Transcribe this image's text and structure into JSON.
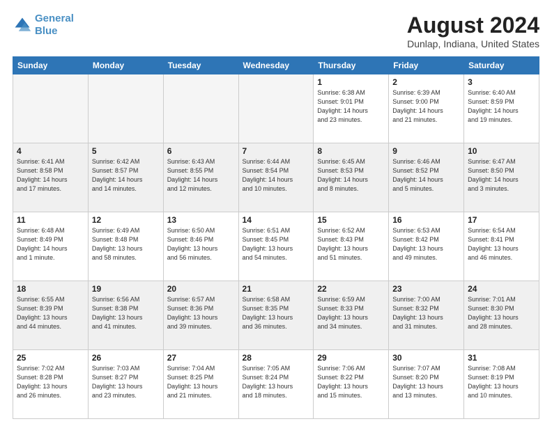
{
  "logo": {
    "line1": "General",
    "line2": "Blue"
  },
  "title": "August 2024",
  "subtitle": "Dunlap, Indiana, United States",
  "headers": [
    "Sunday",
    "Monday",
    "Tuesday",
    "Wednesday",
    "Thursday",
    "Friday",
    "Saturday"
  ],
  "weeks": [
    [
      {
        "num": "",
        "info": ""
      },
      {
        "num": "",
        "info": ""
      },
      {
        "num": "",
        "info": ""
      },
      {
        "num": "",
        "info": ""
      },
      {
        "num": "1",
        "info": "Sunrise: 6:38 AM\nSunset: 9:01 PM\nDaylight: 14 hours\nand 23 minutes."
      },
      {
        "num": "2",
        "info": "Sunrise: 6:39 AM\nSunset: 9:00 PM\nDaylight: 14 hours\nand 21 minutes."
      },
      {
        "num": "3",
        "info": "Sunrise: 6:40 AM\nSunset: 8:59 PM\nDaylight: 14 hours\nand 19 minutes."
      }
    ],
    [
      {
        "num": "4",
        "info": "Sunrise: 6:41 AM\nSunset: 8:58 PM\nDaylight: 14 hours\nand 17 minutes."
      },
      {
        "num": "5",
        "info": "Sunrise: 6:42 AM\nSunset: 8:57 PM\nDaylight: 14 hours\nand 14 minutes."
      },
      {
        "num": "6",
        "info": "Sunrise: 6:43 AM\nSunset: 8:55 PM\nDaylight: 14 hours\nand 12 minutes."
      },
      {
        "num": "7",
        "info": "Sunrise: 6:44 AM\nSunset: 8:54 PM\nDaylight: 14 hours\nand 10 minutes."
      },
      {
        "num": "8",
        "info": "Sunrise: 6:45 AM\nSunset: 8:53 PM\nDaylight: 14 hours\nand 8 minutes."
      },
      {
        "num": "9",
        "info": "Sunrise: 6:46 AM\nSunset: 8:52 PM\nDaylight: 14 hours\nand 5 minutes."
      },
      {
        "num": "10",
        "info": "Sunrise: 6:47 AM\nSunset: 8:50 PM\nDaylight: 14 hours\nand 3 minutes."
      }
    ],
    [
      {
        "num": "11",
        "info": "Sunrise: 6:48 AM\nSunset: 8:49 PM\nDaylight: 14 hours\nand 1 minute."
      },
      {
        "num": "12",
        "info": "Sunrise: 6:49 AM\nSunset: 8:48 PM\nDaylight: 13 hours\nand 58 minutes."
      },
      {
        "num": "13",
        "info": "Sunrise: 6:50 AM\nSunset: 8:46 PM\nDaylight: 13 hours\nand 56 minutes."
      },
      {
        "num": "14",
        "info": "Sunrise: 6:51 AM\nSunset: 8:45 PM\nDaylight: 13 hours\nand 54 minutes."
      },
      {
        "num": "15",
        "info": "Sunrise: 6:52 AM\nSunset: 8:43 PM\nDaylight: 13 hours\nand 51 minutes."
      },
      {
        "num": "16",
        "info": "Sunrise: 6:53 AM\nSunset: 8:42 PM\nDaylight: 13 hours\nand 49 minutes."
      },
      {
        "num": "17",
        "info": "Sunrise: 6:54 AM\nSunset: 8:41 PM\nDaylight: 13 hours\nand 46 minutes."
      }
    ],
    [
      {
        "num": "18",
        "info": "Sunrise: 6:55 AM\nSunset: 8:39 PM\nDaylight: 13 hours\nand 44 minutes."
      },
      {
        "num": "19",
        "info": "Sunrise: 6:56 AM\nSunset: 8:38 PM\nDaylight: 13 hours\nand 41 minutes."
      },
      {
        "num": "20",
        "info": "Sunrise: 6:57 AM\nSunset: 8:36 PM\nDaylight: 13 hours\nand 39 minutes."
      },
      {
        "num": "21",
        "info": "Sunrise: 6:58 AM\nSunset: 8:35 PM\nDaylight: 13 hours\nand 36 minutes."
      },
      {
        "num": "22",
        "info": "Sunrise: 6:59 AM\nSunset: 8:33 PM\nDaylight: 13 hours\nand 34 minutes."
      },
      {
        "num": "23",
        "info": "Sunrise: 7:00 AM\nSunset: 8:32 PM\nDaylight: 13 hours\nand 31 minutes."
      },
      {
        "num": "24",
        "info": "Sunrise: 7:01 AM\nSunset: 8:30 PM\nDaylight: 13 hours\nand 28 minutes."
      }
    ],
    [
      {
        "num": "25",
        "info": "Sunrise: 7:02 AM\nSunset: 8:28 PM\nDaylight: 13 hours\nand 26 minutes."
      },
      {
        "num": "26",
        "info": "Sunrise: 7:03 AM\nSunset: 8:27 PM\nDaylight: 13 hours\nand 23 minutes."
      },
      {
        "num": "27",
        "info": "Sunrise: 7:04 AM\nSunset: 8:25 PM\nDaylight: 13 hours\nand 21 minutes."
      },
      {
        "num": "28",
        "info": "Sunrise: 7:05 AM\nSunset: 8:24 PM\nDaylight: 13 hours\nand 18 minutes."
      },
      {
        "num": "29",
        "info": "Sunrise: 7:06 AM\nSunset: 8:22 PM\nDaylight: 13 hours\nand 15 minutes."
      },
      {
        "num": "30",
        "info": "Sunrise: 7:07 AM\nSunset: 8:20 PM\nDaylight: 13 hours\nand 13 minutes."
      },
      {
        "num": "31",
        "info": "Sunrise: 7:08 AM\nSunset: 8:19 PM\nDaylight: 13 hours\nand 10 minutes."
      }
    ]
  ]
}
